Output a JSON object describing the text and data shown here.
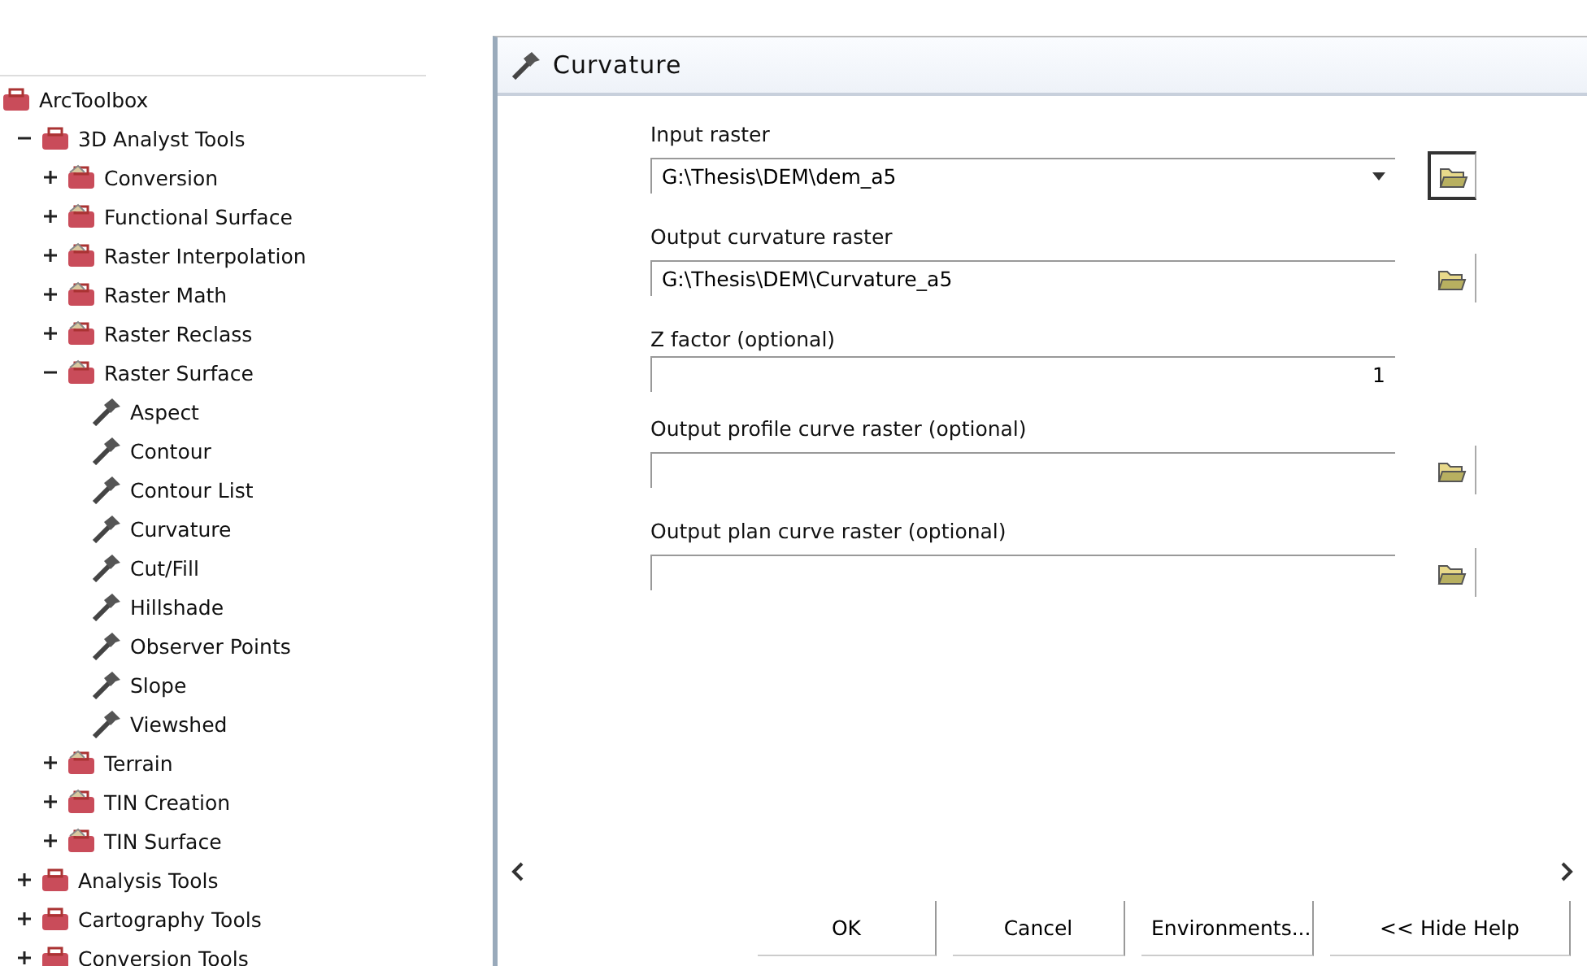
{
  "toolbox": {
    "items": [
      {
        "label": "ArcToolbox",
        "kind": "root",
        "children": [
          {
            "label": "3D Analyst Tools",
            "kind": "toolbox",
            "expanded": true,
            "children": [
              {
                "label": "Conversion",
                "kind": "toolset",
                "expanded": false
              },
              {
                "label": "Functional Surface",
                "kind": "toolset",
                "expanded": false
              },
              {
                "label": "Raster Interpolation",
                "kind": "toolset",
                "expanded": false
              },
              {
                "label": "Raster Math",
                "kind": "toolset",
                "expanded": false
              },
              {
                "label": "Raster Reclass",
                "kind": "toolset",
                "expanded": false
              },
              {
                "label": "Raster Surface",
                "kind": "toolset",
                "expanded": true,
                "children": [
                  {
                    "label": "Aspect",
                    "kind": "tool"
                  },
                  {
                    "label": "Contour",
                    "kind": "tool"
                  },
                  {
                    "label": "Contour List",
                    "kind": "tool"
                  },
                  {
                    "label": "Curvature",
                    "kind": "tool"
                  },
                  {
                    "label": "Cut/Fill",
                    "kind": "tool"
                  },
                  {
                    "label": "Hillshade",
                    "kind": "tool"
                  },
                  {
                    "label": "Observer Points",
                    "kind": "tool"
                  },
                  {
                    "label": "Slope",
                    "kind": "tool"
                  },
                  {
                    "label": "Viewshed",
                    "kind": "tool"
                  }
                ]
              },
              {
                "label": "Terrain",
                "kind": "toolset",
                "expanded": false
              },
              {
                "label": "TIN Creation",
                "kind": "toolset",
                "expanded": false
              },
              {
                "label": "TIN Surface",
                "kind": "toolset",
                "expanded": false
              }
            ]
          },
          {
            "label": "Analysis Tools",
            "kind": "toolbox",
            "expanded": false
          },
          {
            "label": "Cartography Tools",
            "kind": "toolbox",
            "expanded": false
          },
          {
            "label": "Conversion Tools",
            "kind": "toolbox",
            "expanded": false
          }
        ]
      }
    ]
  },
  "dialog": {
    "title": "Curvature",
    "fields": [
      {
        "label": "Input raster",
        "value": "G:\\Thesis\\DEM\\dem_a5",
        "kind": "dropdown"
      },
      {
        "label": "Output curvature raster",
        "value": "G:\\Thesis\\DEM\\Curvature_a5",
        "kind": "path"
      },
      {
        "label": "Z factor (optional)",
        "value": "1",
        "kind": "number"
      },
      {
        "label": "Output profile curve raster (optional)",
        "kind": "path"
      },
      {
        "label": "Output plan curve raster (optional)",
        "kind": "path"
      }
    ],
    "buttons": [
      "OK",
      "Cancel",
      "Environments...",
      "<< Hide Help"
    ]
  }
}
